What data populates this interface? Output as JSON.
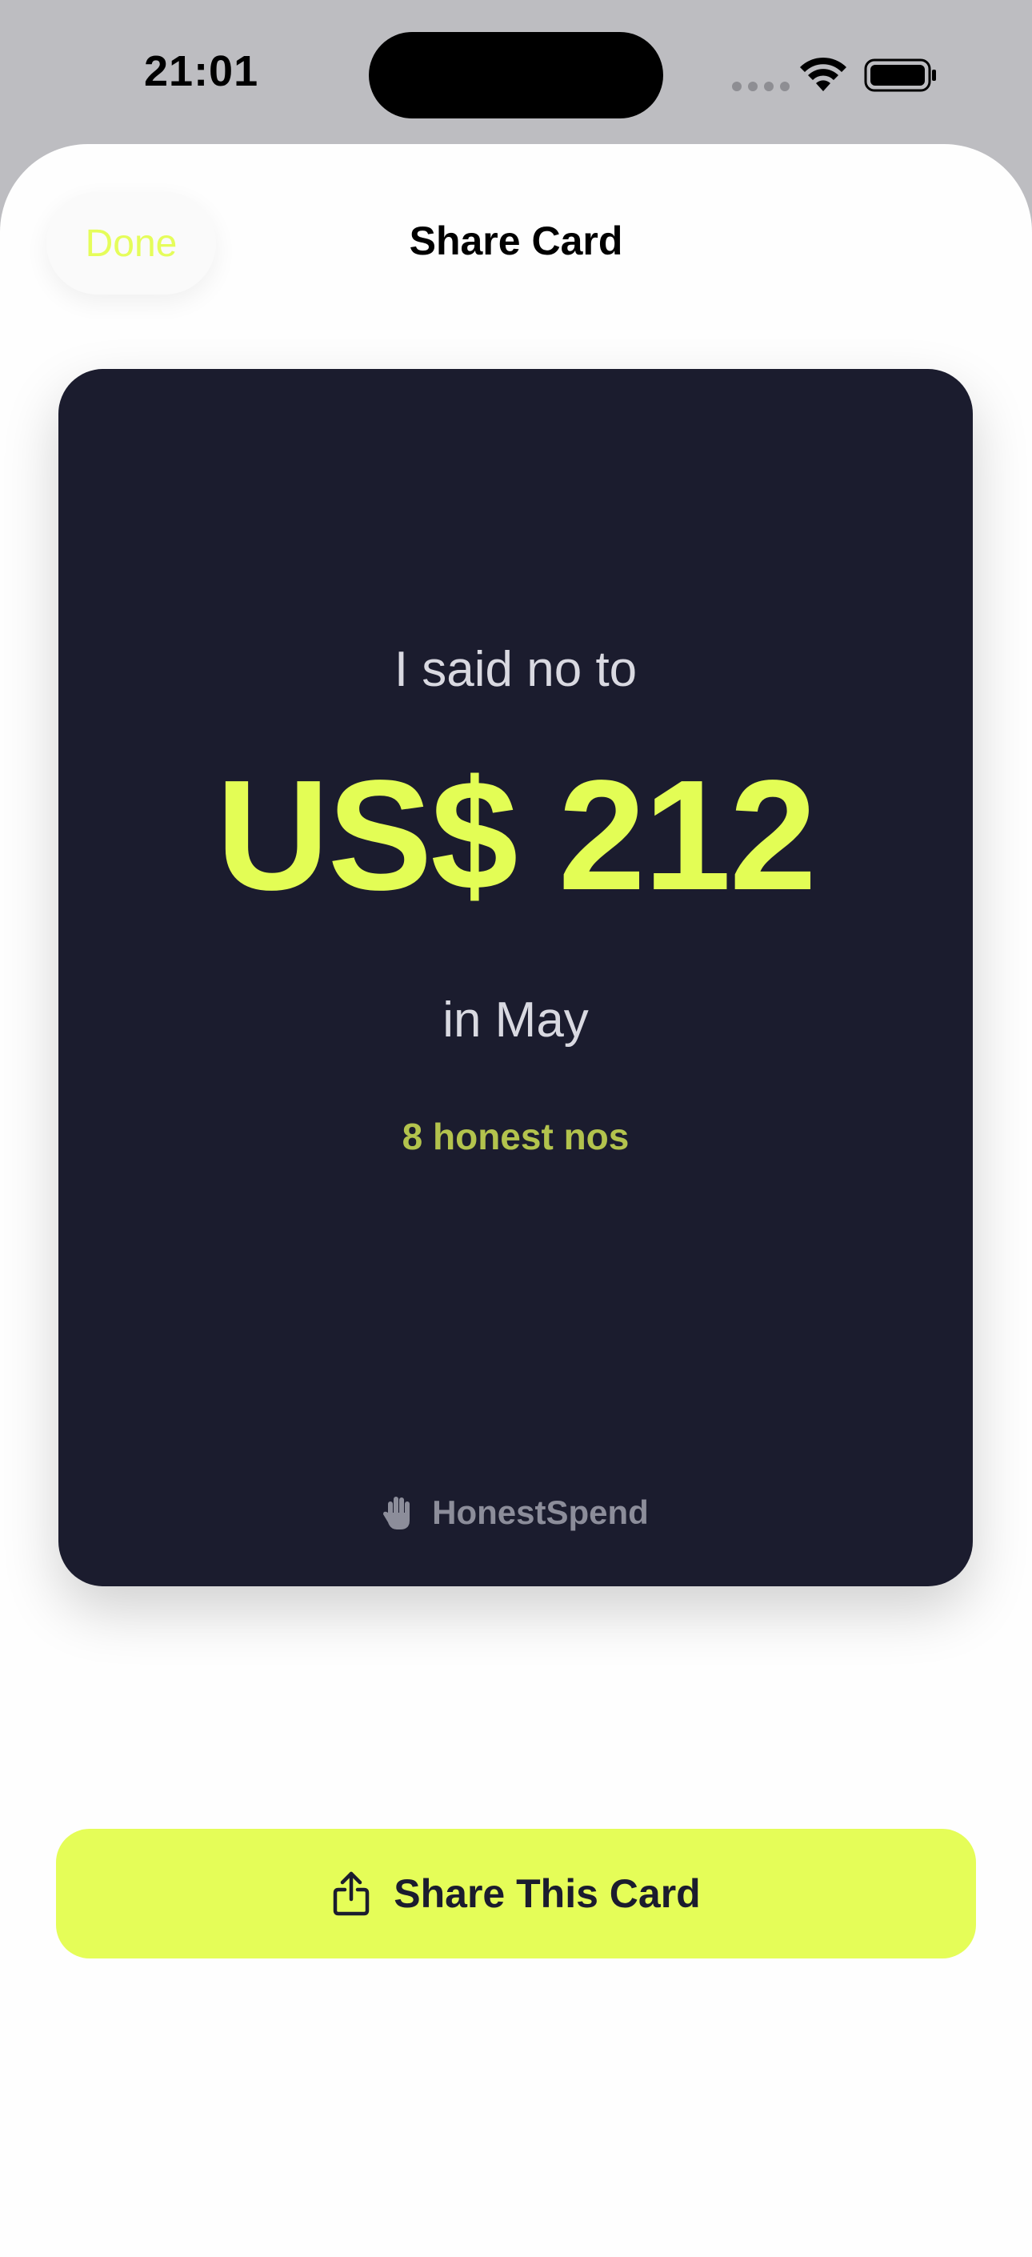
{
  "status_bar": {
    "time": "21:01"
  },
  "sheet": {
    "done_label": "Done",
    "title": "Share Card"
  },
  "card": {
    "intro": "I said no to",
    "amount": "US$ 212",
    "period": "in May",
    "count": "8 honest nos",
    "brand": "HonestSpend",
    "brand_icon": "raised-hand-icon"
  },
  "share": {
    "label": "Share This Card",
    "icon": "share-icon"
  },
  "colors": {
    "accent": "#e5fd58",
    "card_background": "#1b1c2e",
    "amount": "#e3fd55",
    "count": "#b3c34d"
  }
}
